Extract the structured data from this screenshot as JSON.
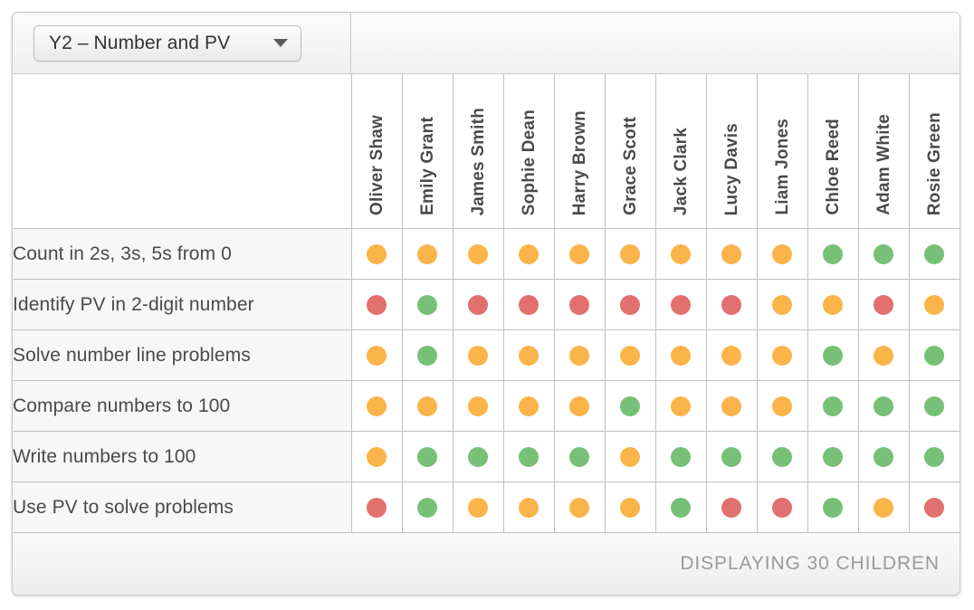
{
  "toolbar": {
    "unit_select": {
      "value": "Y2 – Number and PV",
      "caret_icon": "chevron-down-icon"
    }
  },
  "grid": {
    "corner_label": "",
    "students": [
      "Oliver Shaw",
      "Emily Grant",
      "James Smith",
      "Sophie Dean",
      "Harry Brown",
      "Grace Scott",
      "Jack Clark",
      "Lucy Davis",
      "Liam Jones",
      "Chloe Reed",
      "Adam White",
      "Rosie Green"
    ],
    "objectives": [
      "Count in 2s, 3s, 5s from 0",
      "Identify PV in 2-digit number",
      "Solve number line problems",
      "Compare numbers to 100",
      "Write numbers to 100",
      "Use PV to solve problems"
    ],
    "statuses": [
      [
        "amber",
        "amber",
        "amber",
        "amber",
        "amber",
        "amber",
        "amber",
        "amber",
        "amber",
        "green",
        "green",
        "green"
      ],
      [
        "red",
        "green",
        "red",
        "red",
        "red",
        "red",
        "red",
        "red",
        "amber",
        "amber",
        "red",
        "amber"
      ],
      [
        "amber",
        "green",
        "amber",
        "amber",
        "amber",
        "amber",
        "amber",
        "amber",
        "amber",
        "green",
        "amber",
        "green"
      ],
      [
        "amber",
        "amber",
        "amber",
        "amber",
        "amber",
        "green",
        "amber",
        "amber",
        "amber",
        "green",
        "green",
        "green"
      ],
      [
        "amber",
        "green",
        "green",
        "green",
        "green",
        "amber",
        "green",
        "green",
        "green",
        "green",
        "green",
        "green"
      ],
      [
        "red",
        "green",
        "amber",
        "amber",
        "amber",
        "amber",
        "green",
        "red",
        "red",
        "green",
        "amber",
        "red"
      ]
    ],
    "status_colors": {
      "green": "#76c078",
      "amber": "#fbb44a",
      "red": "#e1706e"
    }
  },
  "footer": {
    "count_text": "DISPLAYING 30 CHILDREN"
  }
}
